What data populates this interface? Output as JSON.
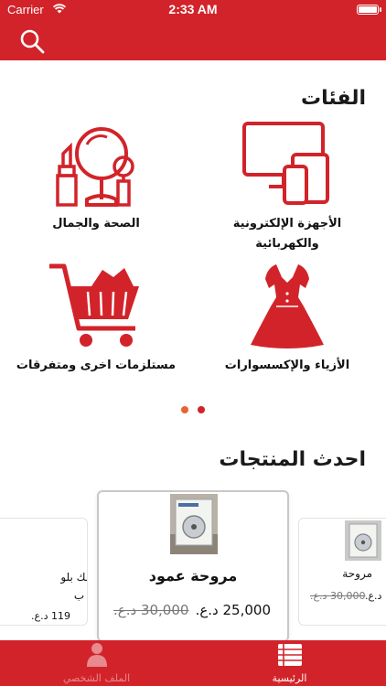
{
  "status_bar": {
    "carrier": "Carrier",
    "time": "2:33 AM"
  },
  "header": {
    "search_icon": "search-icon"
  },
  "categories_section": {
    "title": "الفئات",
    "items": [
      {
        "label_line1": "الأجهزة الإلكترونية",
        "label_line2": "والكهربائية",
        "icon": "devices-icon"
      },
      {
        "label_line1": "الصحة والجمال",
        "label_line2": "",
        "icon": "beauty-icon"
      },
      {
        "label_line1": "الأزياء والإكسسوارات",
        "label_line2": "",
        "icon": "dress-icon"
      },
      {
        "label_line1": "مستلزمات اخرى ومتفرقات",
        "label_line2": "",
        "icon": "cart-icon"
      }
    ],
    "pager": {
      "pages": 2,
      "active_page": 1,
      "active_color": "#e8642f",
      "inactive_color": "#d2232a"
    }
  },
  "products_section": {
    "title": "احدث المنتجات",
    "cards": [
      {
        "title_line1": "بلو آرت سيلك بلو",
        "title_line2": "ساري بدون ب",
        "price": "119 د.ع."
      },
      {
        "title": "مروحة عمود",
        "price": "25,000 د.ع.",
        "old_price": "30,000 د.ع."
      },
      {
        "title": "مروحة",
        "price": "د.ع.",
        "old_price": "30,000 د.ع."
      }
    ]
  },
  "tab_bar": {
    "tabs": [
      {
        "label": "الرئيسية",
        "icon": "list-icon",
        "active": true
      },
      {
        "label": "الملف الشخصي",
        "icon": "person-icon",
        "active": false
      }
    ]
  },
  "colors": {
    "brand": "#d2232a",
    "pager_active": "#e8642f"
  }
}
